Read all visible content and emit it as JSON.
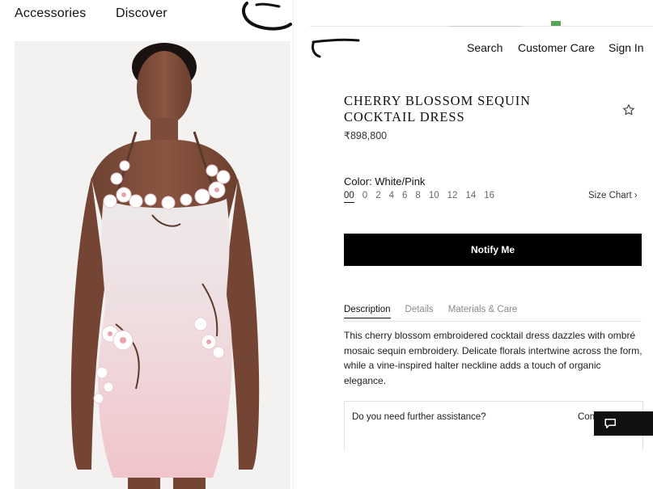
{
  "left_nav": {
    "accessories": "Accessories",
    "discover": "Discover"
  },
  "header": {
    "search": "Search",
    "customer_care": "Customer Care",
    "sign_in": "Sign In"
  },
  "product": {
    "title": "CHERRY BLOSSOM SEQUIN COCKTAIL DRESS",
    "price": "₹898,800",
    "color_label": "Color: White/Pink",
    "sizes": [
      "00",
      "0",
      "2",
      "4",
      "6",
      "8",
      "10",
      "12",
      "14",
      "16"
    ],
    "selected_size": "00",
    "size_chart": "Size Chart ›",
    "notify_button": "Notify Me",
    "tabs": [
      "Description",
      "Details",
      "Materials & Care"
    ],
    "active_tab": "Description",
    "description": "This cherry blossom embroidered cocktail dress dazzles with ombré mosaic sequin embroidery. Delicate florals intertwine across the form, while a vine-inspired halter neckline adds a touch of organic elegance."
  },
  "assistance": {
    "question": "Do you need further assistance?",
    "cta": "Con"
  },
  "icons": {
    "wishlist": "star-outline-icon",
    "chat": "chat-icon"
  },
  "colors": {
    "button_bg": "#000000",
    "dress_top": "#ede9ea",
    "dress_bottom": "#f0c4ca"
  }
}
